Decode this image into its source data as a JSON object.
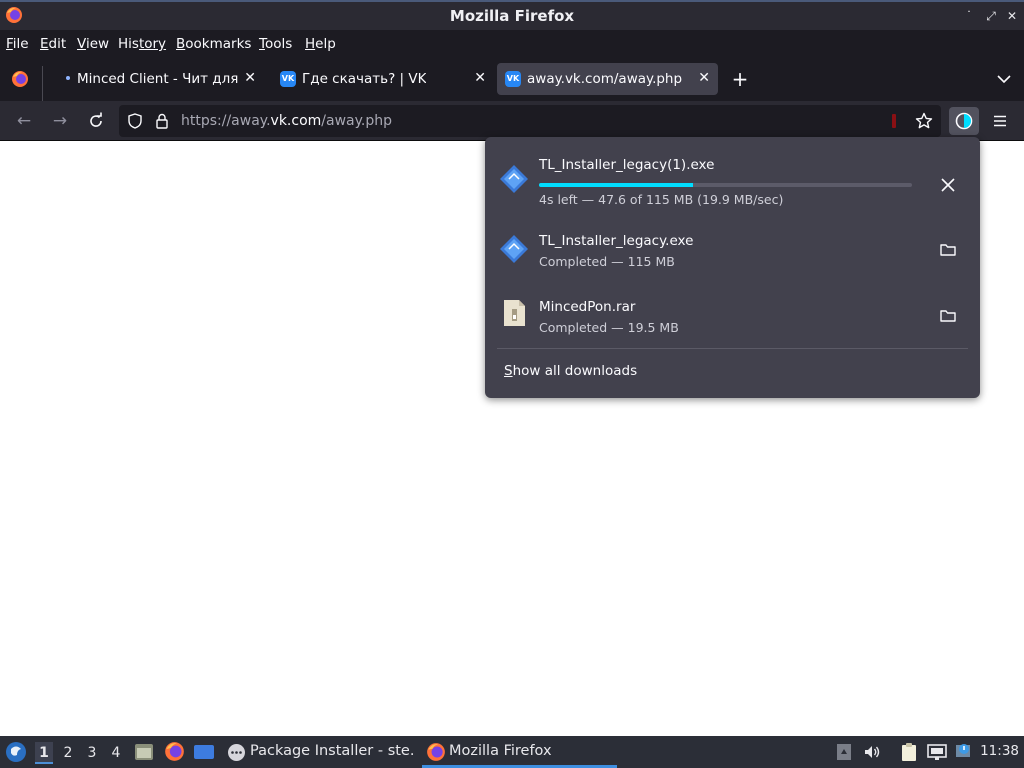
{
  "window": {
    "title": "Mozilla Firefox"
  },
  "menu": [
    {
      "accel": "F",
      "rest": "ile"
    },
    {
      "accel": "E",
      "rest": "dit"
    },
    {
      "accel": "V",
      "rest": "iew"
    },
    {
      "accel": "His",
      "rest": "tory",
      "underline_index": 2
    },
    {
      "accel": "B",
      "rest": "ookmarks"
    },
    {
      "accel": "T",
      "rest": "ools"
    },
    {
      "accel": "H",
      "rest": "elp"
    }
  ],
  "tabs": [
    {
      "label": "Minced Client - Чит для Майнкрафт",
      "active": false,
      "favicon": "unread-dot"
    },
    {
      "label": "Где скачать? | VK",
      "active": false,
      "favicon": "vk-icon"
    },
    {
      "label": "away.vk.com/away.php",
      "active": true,
      "favicon": "vk-icon"
    }
  ],
  "urlbar": {
    "scheme": "https://away.",
    "host": "vk.com",
    "path": "/away.php"
  },
  "downloads": {
    "items": [
      {
        "name": "TL_Installer_legacy(1).exe",
        "status": "4s left — 47.6 of 115 MB (19.9 MB/sec)",
        "in_progress": true,
        "progress": 0.414,
        "icon": "exe-file-icon",
        "action": "cancel"
      },
      {
        "name": "TL_Installer_legacy.exe",
        "status": "Completed — 115 MB",
        "in_progress": false,
        "icon": "exe-file-icon",
        "action": "open-folder"
      },
      {
        "name": "MincedPon.rar",
        "status": "Completed — 19.5 MB",
        "in_progress": false,
        "icon": "archive-file-icon",
        "action": "open-folder"
      }
    ],
    "show_all_accel": "S",
    "show_all_rest": "how all downloads"
  },
  "taskbar": {
    "workspaces": [
      "1",
      "2",
      "3",
      "4"
    ],
    "active_workspace": "1",
    "tasks": [
      {
        "label": "Package Installer - ste...",
        "icon": "package-installer-icon",
        "active": false
      },
      {
        "label": "Mozilla Firefox",
        "icon": "firefox-icon",
        "active": true
      }
    ],
    "clock": "11:38"
  },
  "colors": {
    "accent": "#00ddff",
    "toolbar": "#2b2a33",
    "panel": "#42414d"
  }
}
